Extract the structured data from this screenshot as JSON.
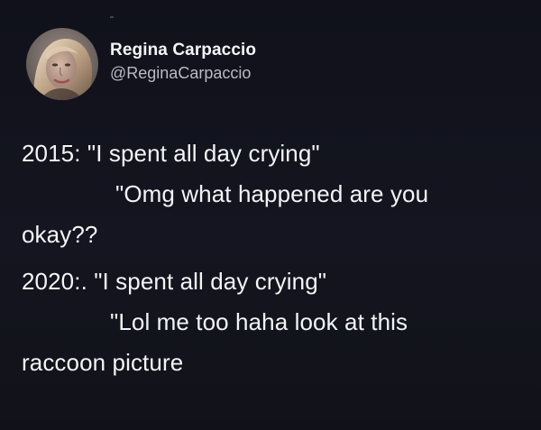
{
  "tweet": {
    "author": {
      "display_name": "Regina Carpaccio",
      "handle": "@ReginaCarpaccio",
      "avatar_icon": "profile-photo-icon"
    },
    "lines": [
      "2015: \"I spent all day crying\"",
      "\"Omg what happened are you",
      "okay??",
      "2020:. \"I spent all day crying\"",
      "\"Lol me too haha look at this",
      "raccoon picture"
    ]
  },
  "colors": {
    "background": "#12131a",
    "text_primary": "#f4f4f6",
    "text_secondary": "#b9bac3"
  }
}
